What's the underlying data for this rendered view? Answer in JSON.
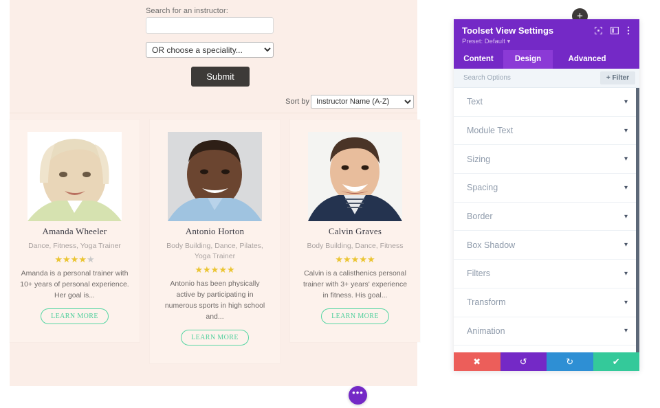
{
  "preview": {
    "search": {
      "label": "Search for an instructor:",
      "input_value": "",
      "input_placeholder": "",
      "speciality_selected": "OR choose a speciality...",
      "speciality_options": [
        "OR choose a speciality..."
      ],
      "submit_label": "Submit"
    },
    "sort": {
      "label": "Sort by",
      "selected": "Instructor Name (A-Z)",
      "options": [
        "Instructor Name (A-Z)"
      ]
    },
    "cards": [
      {
        "name": "Amanda Wheeler",
        "specialities": "Dance, Fitness, Yoga Trainer",
        "rating": 4,
        "rating_max": 5,
        "bio": "Amanda is a personal trainer with 10+ years of personal experience. Her goal is...",
        "button_label": "LEARN MORE",
        "photo_alt": "Amanda Wheeler portrait"
      },
      {
        "name": "Antonio Horton",
        "specialities": "Body Building, Dance, Pilates, Yoga Trainer",
        "rating": 5,
        "rating_max": 5,
        "bio": "Antonio has been physically active by participating in numerous sports in high school and...",
        "button_label": "LEARN MORE",
        "photo_alt": "Antonio Horton portrait"
      },
      {
        "name": "Calvin Graves",
        "specialities": "Body Building, Dance, Fitness",
        "rating": 5,
        "rating_max": 5,
        "bio": "Calvin is a calisthenics personal trainer with 3+ years' experience in fitness. His goal...",
        "button_label": "LEARN MORE",
        "photo_alt": "Calvin Graves portrait"
      }
    ],
    "fab_label": "•••",
    "add_button_label": "+"
  },
  "panel": {
    "title": "Toolset View Settings",
    "preset": "Preset: Default ▾",
    "header_icons": [
      "focus-target-icon",
      "panel-layout-icon",
      "more-vertical-icon"
    ],
    "tabs": [
      {
        "label": "Content",
        "active": false
      },
      {
        "label": "Design",
        "active": true
      },
      {
        "label": "Advanced",
        "active": false
      }
    ],
    "search_options_placeholder": "Search Options",
    "filter_label": "+ Filter",
    "options": [
      {
        "label": "Text"
      },
      {
        "label": "Module Text"
      },
      {
        "label": "Sizing"
      },
      {
        "label": "Spacing"
      },
      {
        "label": "Border"
      },
      {
        "label": "Box Shadow"
      },
      {
        "label": "Filters"
      },
      {
        "label": "Transform"
      },
      {
        "label": "Animation"
      }
    ],
    "actions": [
      {
        "name": "cancel",
        "glyph": "✖",
        "color": "#ec5e5a"
      },
      {
        "name": "undo",
        "glyph": "↺",
        "color": "#7429c6"
      },
      {
        "name": "redo",
        "glyph": "↻",
        "color": "#2e8fd4"
      },
      {
        "name": "save",
        "glyph": "✔",
        "color": "#34c99a"
      }
    ]
  },
  "colors": {
    "page_bg": "#fbeee8",
    "card_bg": "#fdf2ec",
    "brand_purple": "#7429c6",
    "accent_green": "#4fcf9c",
    "star_gold": "#ebc533",
    "star_off": "#c9c9c9"
  }
}
